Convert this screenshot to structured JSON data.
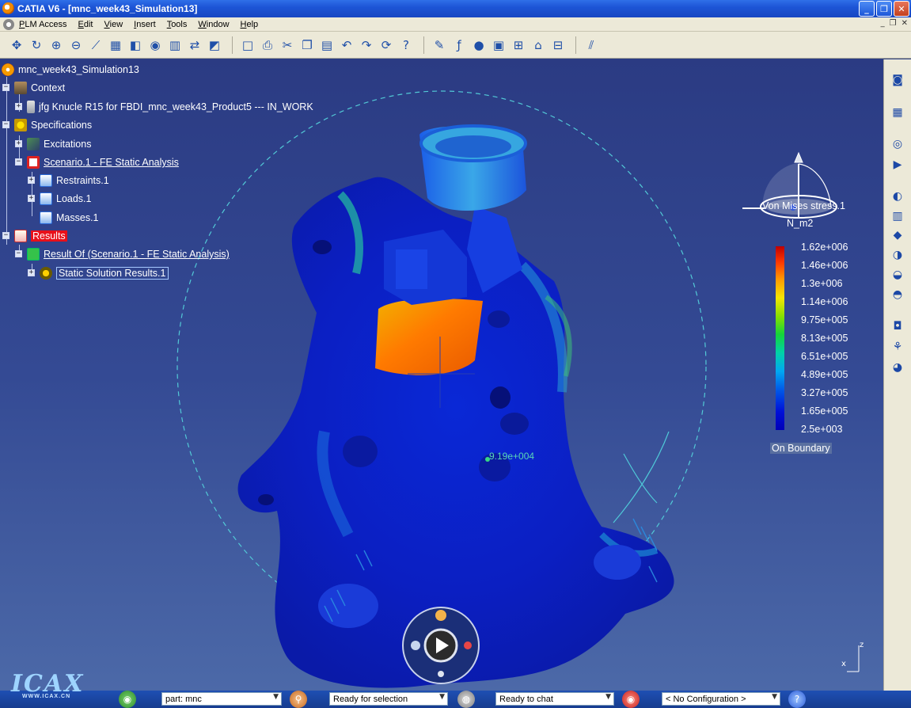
{
  "window": {
    "title": "CATIA V6 - [mnc_week43_Simulation13]",
    "minimize": "_",
    "restore": "❐",
    "close": "✕"
  },
  "menu": {
    "items": [
      "PLM Access",
      "Edit",
      "View",
      "Insert",
      "Tools",
      "Window",
      "Help"
    ],
    "mdi_minimize": "_",
    "mdi_restore": "❐",
    "mdi_close": "✕"
  },
  "toolbar": {
    "icons": [
      "move-icon",
      "rotate-icon",
      "zoom-in-icon",
      "zoom-out-icon",
      "normal-view-icon",
      "multi-view-icon",
      "iso-view-icon",
      "shading-icon",
      "hide-show-icon",
      "swap-icon",
      "new-icon",
      "print-icon",
      "cut-icon",
      "copy-icon",
      "paste-icon",
      "undo-icon",
      "redo-icon",
      "update-icon",
      "whats-this-icon",
      "formula-icon",
      "comment-icon",
      "catalog-icon",
      "tree-icon",
      "lock-icon",
      "measure-icon",
      "analysis-icon"
    ]
  },
  "tree": {
    "root": "mnc_week43_Simulation13",
    "context": "Context",
    "product": "jfg Knucle R15 for FBDI_mnc_week43_Product5 --- IN_WORK",
    "specifications": "Specifications",
    "excitations": "Excitations",
    "scenario": "Scenario.1 - FE Static Analysis",
    "restraints": "Restraints.1",
    "loads": "Loads.1",
    "masses": "Masses.1",
    "results": "Results",
    "result_of": "Result Of (Scenario.1 - FE Static Analysis)",
    "static_solution": "Static Solution Results.1"
  },
  "legend": {
    "title": "Von Mises stress.1",
    "unit": "N_m2",
    "ticks": [
      "1.62e+006",
      "1.46e+006",
      "1.3e+006",
      "1.14e+006",
      "9.75e+005",
      "8.13e+005",
      "6.51e+005",
      "4.89e+005",
      "3.27e+005",
      "1.65e+005",
      "2.5e+003"
    ],
    "boundary": "On Boundary"
  },
  "probe": {
    "value": "9.19e+004"
  },
  "compass": {
    "x_label": "x",
    "z_label": "z"
  },
  "status": {
    "part_field": "part: mnc",
    "selection_field": "Ready for selection",
    "chat_field": "Ready to chat",
    "config_field": "< No Configuration >"
  },
  "watermark": {
    "logo": "ICAX",
    "url": "WWW.ICAX.CN"
  },
  "colors": {
    "viewport_top": "#2b3b83",
    "viewport_bottom": "#4c69a8",
    "selected_results": "#e8101a",
    "legend_max": "#c00000",
    "legend_min": "#0000b8"
  }
}
